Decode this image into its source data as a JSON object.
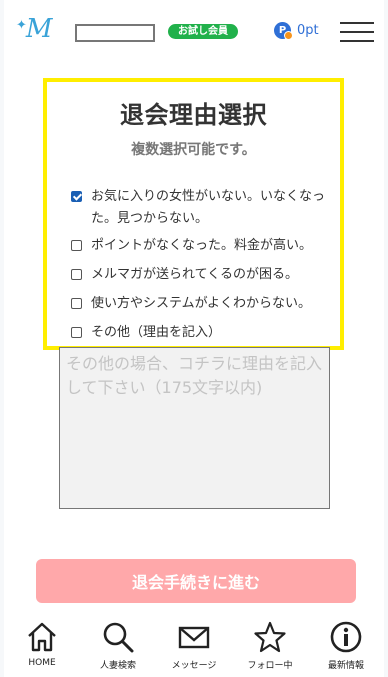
{
  "header": {
    "logo_text": "M",
    "logo_spark": "✦",
    "badge": "お試し会員",
    "points_icon": "P",
    "points": "0pt"
  },
  "panel": {
    "title": "退会理由選択",
    "subtitle": "複数選択可能です。",
    "options": [
      {
        "label": "お気に入りの女性がいない。いなくなった。見つからない。",
        "checked": true
      },
      {
        "label": "ポイントがなくなった。料金が高い。",
        "checked": false
      },
      {
        "label": "メルマガが送られてくるのが困る。",
        "checked": false
      },
      {
        "label": "使い方やシステムがよくわからない。",
        "checked": false
      },
      {
        "label": "その他（理由を記入）",
        "checked": false
      }
    ]
  },
  "reason": {
    "placeholder": "その他の場合、コチラに理由を記入して下さい（175文字以内)"
  },
  "submit_label": "退会手続きに進む",
  "nav": [
    {
      "label": "HOME",
      "icon": "home-icon"
    },
    {
      "label": "人妻検索",
      "icon": "search-icon"
    },
    {
      "label": "メッセージ",
      "icon": "mail-icon"
    },
    {
      "label": "フォロー中",
      "icon": "star-icon"
    },
    {
      "label": "最新情報",
      "icon": "info-icon"
    }
  ],
  "colors": {
    "accent_blue": "#2f6fd6",
    "badge_green": "#21b14b",
    "panel_border": "#ffee00",
    "submit_bg": "#ffa8aa"
  }
}
